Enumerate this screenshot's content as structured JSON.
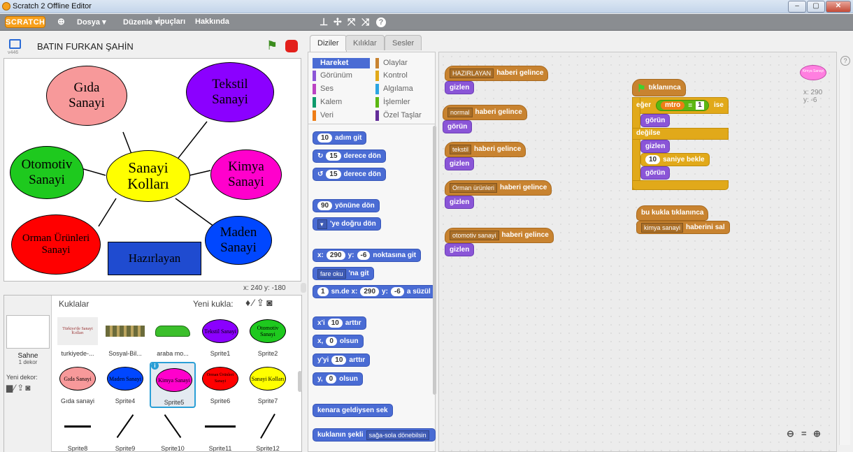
{
  "window": {
    "title": "Scratch 2 Offline Editor",
    "min": "‒",
    "max": "▢",
    "close": "✕"
  },
  "menu": {
    "logo": "SCRATCH",
    "items": [
      "Dosya ▾",
      "Düzenle ▾",
      "İpuçları",
      "Hakkında"
    ]
  },
  "stage": {
    "project_name": "BATIN FURKAN ŞAHİN",
    "version": "v446",
    "coords": "x: 240  y: -180",
    "center": "Sanayi Kolları",
    "nodes": [
      "Gıda Sanayi",
      "Tekstil Sanayi",
      "Otomotiv Sanayi",
      "Kimya Sanayi",
      "Orman Ürünleri Sanayi",
      "Maden Sanayi"
    ],
    "button": "Hazırlayan"
  },
  "sprites": {
    "header": "Kuklalar",
    "new_sprite": "Yeni kukla:",
    "stage_label": "Sahne",
    "stage_sub": "1 dekor",
    "new_backdrop": "Yeni dekor:",
    "items": [
      "turkiyede-...",
      "Sosyal-Bil...",
      "araba mo...",
      "Sprite1",
      "Sprite2",
      "Gıda sanayi",
      "Sprite4",
      "Sprite5",
      "Sprite6",
      "Sprite7",
      "Sprite8",
      "Sprite9",
      "Sprite10",
      "Sprite11",
      "Sprite12"
    ],
    "thumb_text": {
      "s1": "Tekstil Sanayi",
      "s2": "Otomotiv Sanayi",
      "gida": "Gıda Sanayi",
      "s4": "Maden Sanayi",
      "s5": "Kimya Sanayi",
      "s6": "Orman Ürünleri Sanayi",
      "s7": "Sanayi Kolları",
      "turk": "Türkiye'de Sanayi Kolları"
    }
  },
  "tabs": [
    "Diziler",
    "Kılıklar",
    "Sesler"
  ],
  "categories": {
    "left": [
      "Hareket",
      "Görünüm",
      "Ses",
      "Kalem",
      "Veri"
    ],
    "right": [
      "Olaylar",
      "Kontrol",
      "Algılama",
      "İşlemler",
      "Özel Taşlar"
    ]
  },
  "palette": {
    "move": "adım git",
    "move_n": "10",
    "turn_r": "derece dön",
    "turn_n": "15",
    "turn_l": "derece dön",
    "point": "yönüne dön",
    "point_n": "90",
    "point_to": "'ye doğru dön",
    "goto": "noktasına git",
    "gx": "290",
    "gy": "-6",
    "goto_mouse": "'na git",
    "mouse": "fare oku",
    "glide": "sn.de x:",
    "glide_n": "1",
    "glide_tail": "a süzül",
    "chx": "arttır",
    "chx_label": "x'i",
    "chx_n": "10",
    "setx": "olsun",
    "setx_label": "x,",
    "zero": "0",
    "chy_label": "y'yi",
    "sety_label": "y,",
    "bounce": "kenara geldiysen sek",
    "rot": "kuklanın şekli",
    "rot_opt": "sağa-sola dönebilsin"
  },
  "scripts": {
    "when_receive": "haberi gelince",
    "hide": "gizlen",
    "show": "görün",
    "msgs": [
      "HAZIRLAYAN",
      "normal",
      "tekstil",
      "Orman ürünleri",
      "otomotiv sanayi"
    ],
    "flag_clicked": "tıklanınca",
    "if": "eğer",
    "var": "mtro",
    "eq": "=",
    "val": "1",
    "then": "ise",
    "else": "değilse",
    "wait": "saniye bekle",
    "wait_n": "10",
    "sprite_clicked": "bu kukla tıklanınca",
    "broadcast": "haberini sal",
    "broadcast_msg": "kimya sanayi",
    "xy": "x: 290\ny: -6",
    "corner_sprite": "Kimya Sanayi",
    "zoom": [
      "🔍−",
      "=",
      "🔍+"
    ]
  },
  "colors": {
    "motion": "#4a6cd4",
    "looks": "#8a55d7",
    "events": "#c88330",
    "control": "#e1a91a",
    "operators": "#5cb712",
    "menubar": "#8a8d91"
  }
}
